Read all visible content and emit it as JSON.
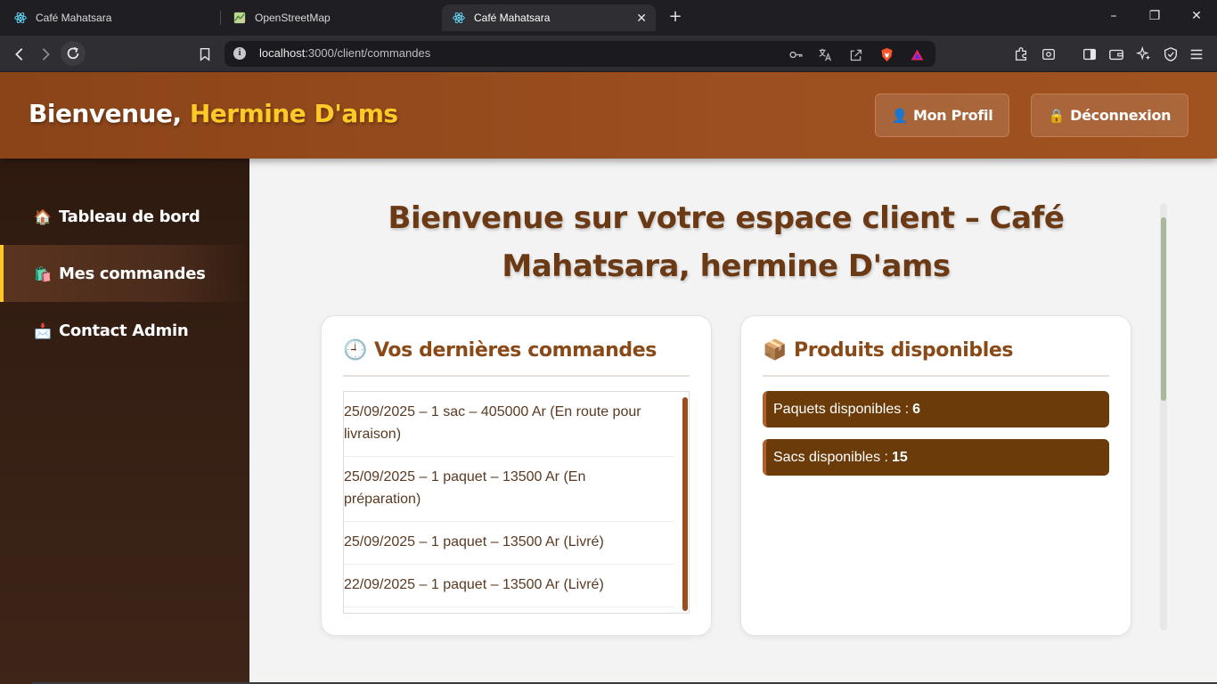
{
  "browser": {
    "tabs": [
      {
        "title": "Café Mahatsara",
        "icon": "react-icon",
        "active": false
      },
      {
        "title": "OpenStreetMap",
        "icon": "map-icon",
        "active": false
      },
      {
        "title": "Café Mahatsara",
        "icon": "react-icon",
        "active": true
      }
    ],
    "url_host": "localhost",
    "url_path": ":3000/client/commandes",
    "window_controls": [
      "–",
      "❐",
      "✕"
    ]
  },
  "header": {
    "welcome_prefix": "Bienvenue, ",
    "user_name": "Hermine D'ams",
    "profile_button": {
      "emoji": "👤",
      "label": "Mon Profil"
    },
    "logout_button": {
      "emoji": "🔒",
      "label": "Déconnexion"
    },
    "colors": {
      "background": "#9c4f20",
      "accent": "#ffc928"
    }
  },
  "sidebar": {
    "items": [
      {
        "emoji": "🏠",
        "label": "Tableau de bord",
        "active": false
      },
      {
        "emoji": "🛍️",
        "label": "Mes commandes",
        "active": true
      },
      {
        "emoji": "📩",
        "label": "Contact Admin",
        "active": false
      }
    ]
  },
  "main": {
    "title": "Bienvenue sur votre espace client – Café Mahatsara, hermine D'ams",
    "orders_card": {
      "emoji": "🕘",
      "title": "Vos dernières commandes",
      "orders": [
        "25/09/2025 – 1 sac – 405000 Ar (En route pour livraison)",
        "25/09/2025 – 1 paquet – 13500 Ar (En préparation)",
        "25/09/2025 – 1 paquet – 13500 Ar (Livré)",
        "22/09/2025 – 1 paquet – 13500 Ar (Livré)"
      ]
    },
    "products_card": {
      "emoji": "📦",
      "title": "Produits disponibles",
      "stock": [
        {
          "label": "Paquets disponibles :",
          "value": "6"
        },
        {
          "label": "Sacs disponibles :",
          "value": "15"
        }
      ]
    }
  }
}
